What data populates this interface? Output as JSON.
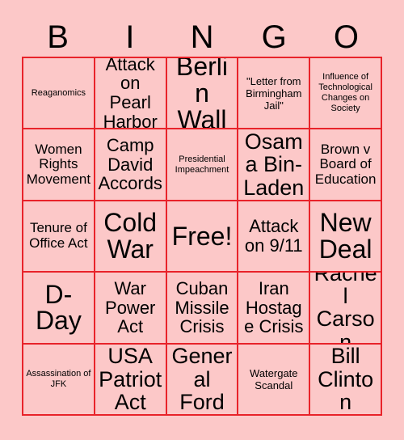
{
  "card": {
    "title_letters": [
      "B",
      "I",
      "N",
      "G",
      "O"
    ],
    "colors": {
      "background": "#fcc8c8",
      "cell_background": "#fcc8c8",
      "grid_line": "#e8232a",
      "text": "#000000"
    },
    "rows": [
      [
        {
          "label": "Reaganomics",
          "size": "xs",
          "free": false
        },
        {
          "label": "Attack on Pearl Harbor",
          "size": "l",
          "free": false
        },
        {
          "label": "Berlin Wall",
          "size": "xxl",
          "free": false
        },
        {
          "label": "\"Letter from Birmingham Jail\"",
          "size": "s",
          "free": false
        },
        {
          "label": "Influence of Technological Changes on Society",
          "size": "xs",
          "free": false
        }
      ],
      [
        {
          "label": "Women Rights Movement",
          "size": "m",
          "free": false
        },
        {
          "label": "Camp David Accords",
          "size": "l",
          "free": false
        },
        {
          "label": "Presidential Impeachment",
          "size": "xs",
          "free": false
        },
        {
          "label": "Osama Bin-Laden",
          "size": "xl",
          "free": false
        },
        {
          "label": "Brown v Board of Education",
          "size": "m",
          "free": false
        }
      ],
      [
        {
          "label": "Tenure of Office Act",
          "size": "m",
          "free": false
        },
        {
          "label": "Cold War",
          "size": "xxl",
          "free": false
        },
        {
          "label": "Free!",
          "size": "xxl",
          "free": true
        },
        {
          "label": "Attack on 9/11",
          "size": "l",
          "free": false
        },
        {
          "label": "New Deal",
          "size": "xxl",
          "free": false
        }
      ],
      [
        {
          "label": "D-Day",
          "size": "xxl",
          "free": false
        },
        {
          "label": "War Power Act",
          "size": "l",
          "free": false
        },
        {
          "label": "Cuban Missile Crisis",
          "size": "l",
          "free": false
        },
        {
          "label": "Iran Hostage Crisis",
          "size": "l",
          "free": false
        },
        {
          "label": "Rachel Carson",
          "size": "xl",
          "free": false
        }
      ],
      [
        {
          "label": "Assassination of JFK",
          "size": "xs",
          "free": false
        },
        {
          "label": "USA Patriot Act",
          "size": "xl",
          "free": false
        },
        {
          "label": "General Ford",
          "size": "xl",
          "free": false
        },
        {
          "label": "Watergate Scandal",
          "size": "s",
          "free": false
        },
        {
          "label": "Bill Clinton",
          "size": "xl",
          "free": false
        }
      ]
    ]
  }
}
